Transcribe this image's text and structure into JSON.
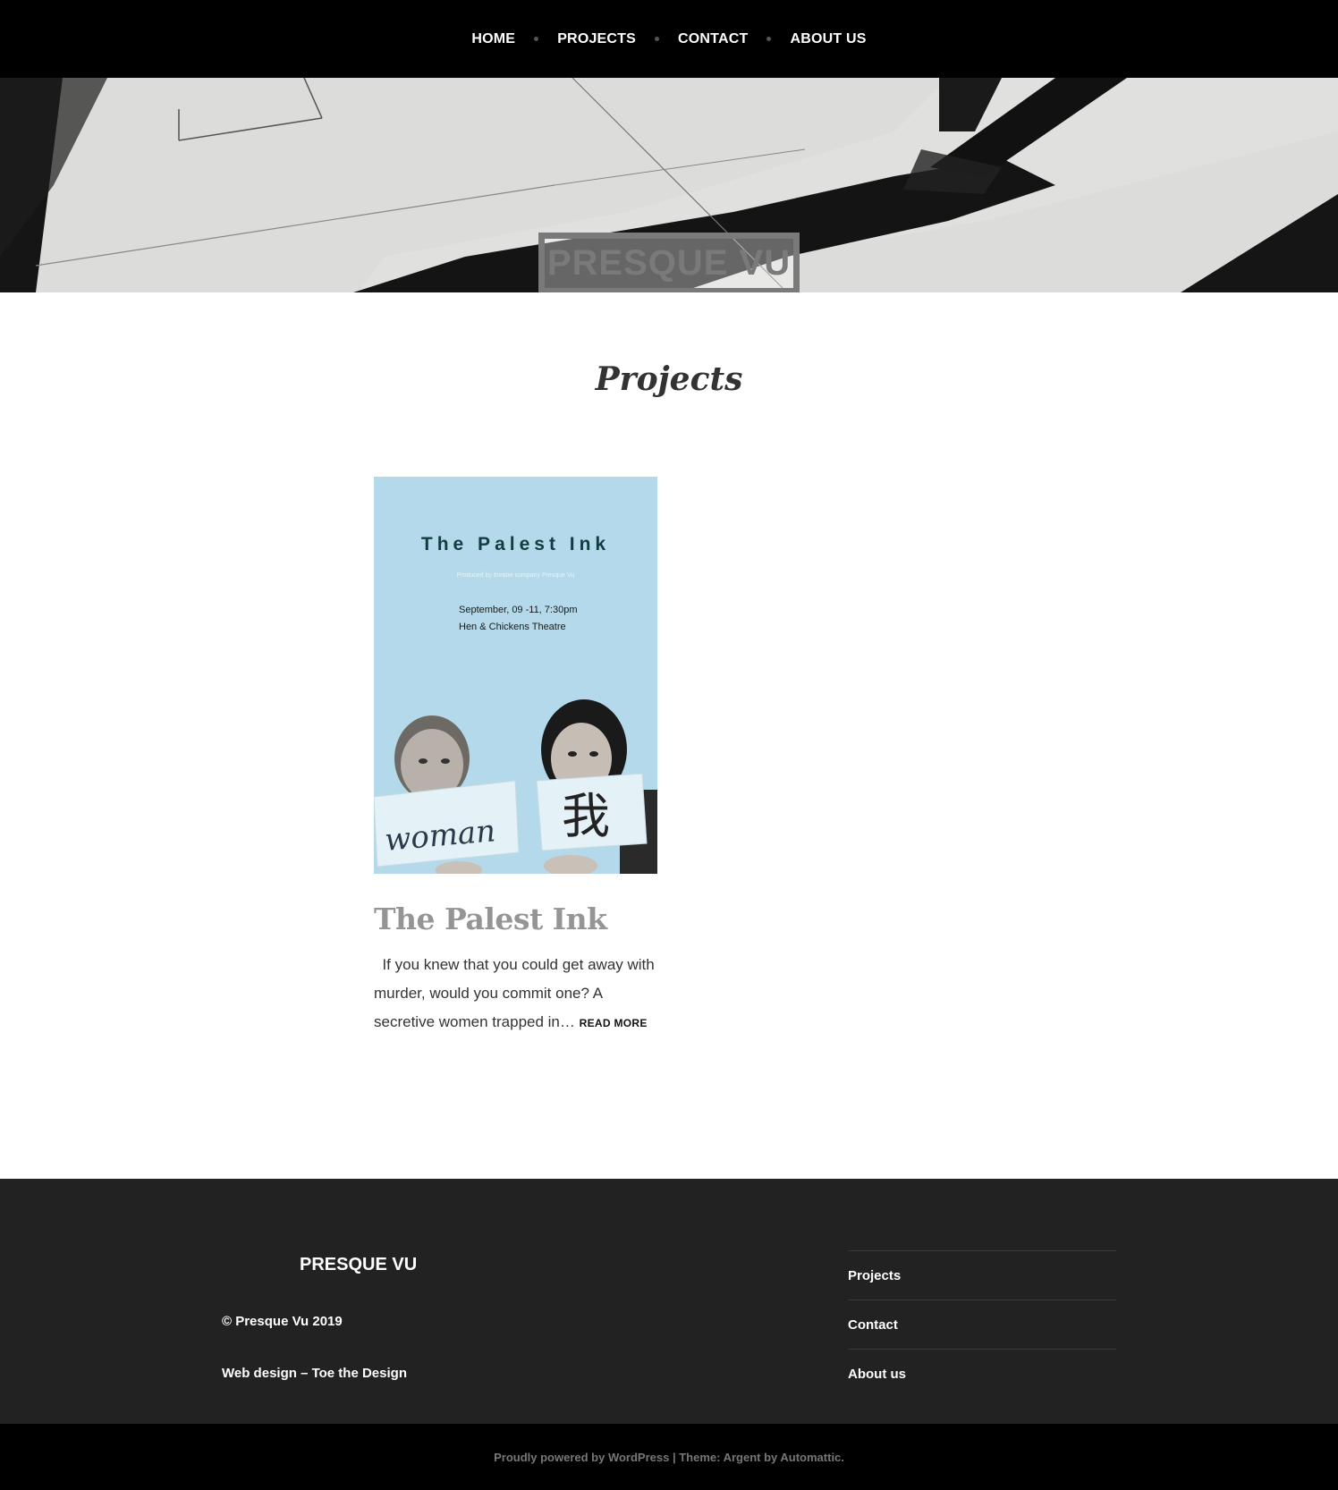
{
  "nav": {
    "items": [
      {
        "label": "HOME"
      },
      {
        "label": "PROJECTS"
      },
      {
        "label": "CONTACT"
      },
      {
        "label": "ABOUT US"
      }
    ]
  },
  "hero": {
    "site_title": "PRESQUE VU"
  },
  "main": {
    "page_title": "Projects",
    "project": {
      "poster_title": "The Palest Ink",
      "poster_producer": "Produced by theatre company Presque Vu",
      "poster_date": "September, 09 -11, 7:30pm",
      "poster_venue": "Hen & Chickens Theatre",
      "poster_sign_left": "woman",
      "poster_sign_right": "我",
      "title": "The Palest Ink",
      "excerpt": "  If you knew that you could get away with murder, would you commit one? A secretive women trapped in…",
      "read_more": "READ MORE"
    }
  },
  "footer": {
    "brand": "PRESQUE VU",
    "copyright": "© Presque Vu 2019",
    "credit": "Web design – Toe the Design",
    "menu": [
      {
        "label": "Projects"
      },
      {
        "label": "Contact"
      },
      {
        "label": "About us"
      }
    ]
  },
  "bottom_bar": {
    "powered_by": "Proudly powered by WordPress",
    "separator": " | ",
    "theme_text": "Theme: Argent by Automattic."
  },
  "colors": {
    "nav_bg": "#000000",
    "footer_bg": "#222222",
    "poster_bg": "#b4d9ea",
    "title_gray": "#959595"
  }
}
